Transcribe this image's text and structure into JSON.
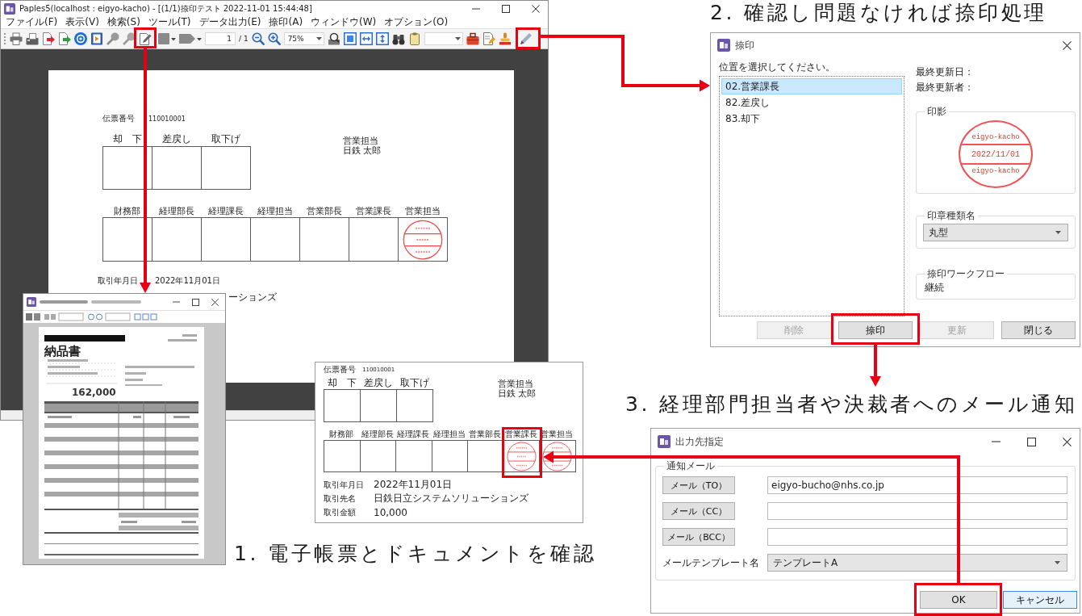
{
  "main_window": {
    "title": "Paples5(localhost : eigyo-kacho) - [(1/1)捺印テスト 2022-11-01 15:44:48]",
    "menu": [
      "ファイル(F)",
      "表示(V)",
      "検索(S)",
      "ツール(T)",
      "データ出力(E)",
      "捺印(A)",
      "ウィンドウ(W)",
      "オプション(O)"
    ],
    "toolbar": {
      "page": "1",
      "page_total": "/ 1",
      "zoom": "75%"
    },
    "document": {
      "slip_label": "伝票番号",
      "slip_number": "110010001",
      "top_boxes": [
        "却　下",
        "差戻し",
        "取下げ"
      ],
      "sales_rep": {
        "label": "営業担当",
        "name": "日鉄 太郎"
      },
      "approvers": [
        {
          "label": "財務部",
          "stamped": false
        },
        {
          "label": "経理部長",
          "stamped": false
        },
        {
          "label": "経理課長",
          "stamped": false
        },
        {
          "label": "経理担当",
          "stamped": false
        },
        {
          "label": "営業部長",
          "stamped": false
        },
        {
          "label": "営業課長",
          "stamped": false
        },
        {
          "label": "営業担当",
          "stamped": true
        }
      ],
      "fields": [
        {
          "label": "取引年月日",
          "value": "2022年11月01日"
        }
      ],
      "covered_row_text": "ーションズ"
    }
  },
  "document_viewer": {
    "heading": "納品書",
    "amount": "162,000"
  },
  "form_preview": {
    "slip_label": "伝票番号",
    "slip_number": "110010001",
    "top_boxes": [
      "却　下",
      "差戻し",
      "取下げ"
    ],
    "sales_rep": {
      "label": "営業担当",
      "name": "日鉄 太郎"
    },
    "approvers": [
      {
        "label": "財務部",
        "stamped": false
      },
      {
        "label": "経理部長",
        "stamped": false
      },
      {
        "label": "経理課長",
        "stamped": false
      },
      {
        "label": "経理担当",
        "stamped": false
      },
      {
        "label": "営業部長",
        "stamped": false
      },
      {
        "label": "営業課長",
        "stamped": true
      },
      {
        "label": "営業担当",
        "stamped": true
      }
    ],
    "fields": [
      {
        "label": "取引年月日",
        "value": "2022年11月01日"
      },
      {
        "label": "取引先名",
        "value": "日鉄日立システムソリューションズ"
      },
      {
        "label": "取引金額",
        "value": "10,000"
      }
    ]
  },
  "stamp_dialog": {
    "title": "捺印",
    "prompt": "位置を選択してください。",
    "positions": [
      {
        "label": "02.営業課長",
        "selected": true
      },
      {
        "label": "82.差戻し",
        "selected": false
      },
      {
        "label": "83.却下",
        "selected": false
      }
    ],
    "last_updated_label": "最終更新日：",
    "last_updater_label": "最終更新者：",
    "impression_label": "印影",
    "impression": {
      "top": "eigyo-kacho",
      "date": "2022/11/01",
      "bottom": "eigyo-kacho"
    },
    "seal_type_label": "印章種類名",
    "seal_type": "丸型",
    "workflow_label": "捺印ワークフロー",
    "workflow": "継続",
    "buttons": [
      {
        "label": "削除",
        "disabled": true
      },
      {
        "label": "捺印",
        "disabled": false
      },
      {
        "label": "更新",
        "disabled": true
      },
      {
        "label": "閉じる",
        "disabled": false
      }
    ]
  },
  "output_dialog": {
    "title": "出力先指定",
    "group_label": "通知メール",
    "recipients": [
      {
        "button": "メール（TO）",
        "value": "eigyo-bucho@nhs.co.jp"
      },
      {
        "button": "メール（CC）"
      },
      {
        "button": "メール（BCC）"
      }
    ],
    "template_label": "メールテンプレート名",
    "template": "テンプレートA",
    "buttons": [
      {
        "label": "OK",
        "focused": false
      },
      {
        "label": "キャンセル",
        "focused": true
      }
    ]
  },
  "captions": [
    {
      "kind": "stamp",
      "text": "2. 確認し問題なければ捺印処理"
    },
    {
      "kind": "notify",
      "text": "3. 経理部門担当者や決裁者へのメール通知"
    },
    {
      "kind": "check",
      "text": "1. 電子帳票とドキュメントを確認"
    }
  ]
}
